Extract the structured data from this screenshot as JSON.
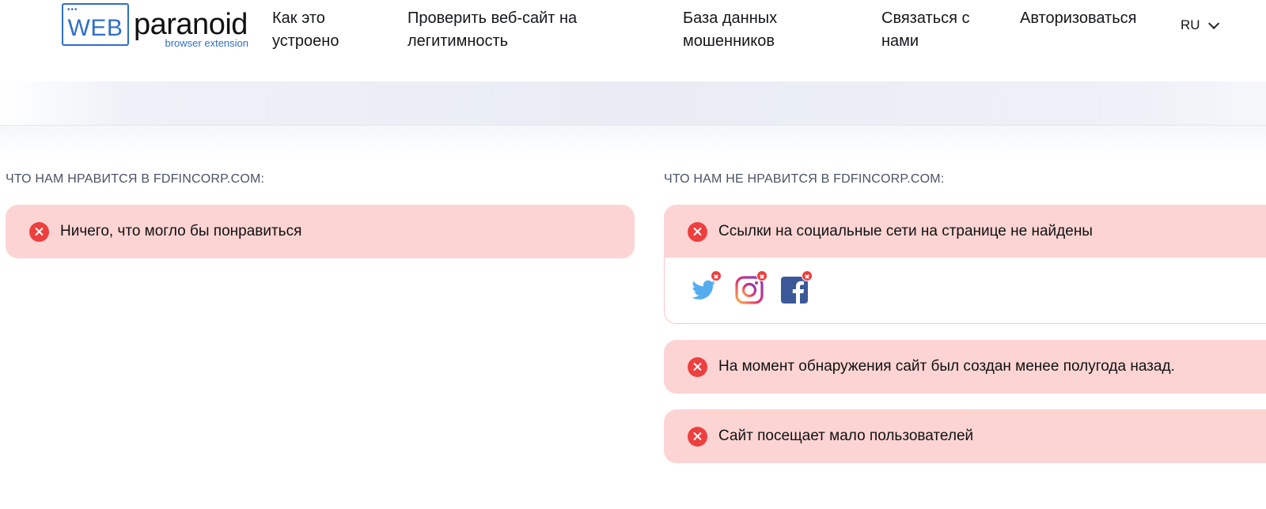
{
  "logo": {
    "dots": "•••",
    "web": "WEB",
    "name": "paranoid",
    "subtitle": "browser extension"
  },
  "nav": {
    "items": [
      {
        "label": "Как это устроено"
      },
      {
        "label": "Проверить веб-сайт на легитимность"
      },
      {
        "label": "База данных мошенников"
      },
      {
        "label": "Связаться с нами"
      },
      {
        "label": "Авторизоваться"
      }
    ],
    "language": "RU"
  },
  "likes": {
    "title": "ЧТО НАМ НРАВИТСЯ В FDFINCORP.COM:",
    "items": [
      {
        "text": "Ничего, что могло бы понравиться",
        "status_icon": "x-circle-icon"
      }
    ]
  },
  "dislikes": {
    "title": "ЧТО НАМ НЕ НРАВИТСЯ В FDFINCORP.COM:",
    "items": [
      {
        "text": "Ссылки на социальные сети на странице не найдены",
        "status_icon": "x-circle-icon"
      },
      {
        "text": "На момент обнаружения сайт был создан менее полугода назад.",
        "status_icon": "x-circle-icon"
      },
      {
        "text": "Сайт посещает мало пользователей",
        "status_icon": "x-circle-icon"
      }
    ],
    "social_icons": [
      "twitter-icon",
      "instagram-icon",
      "facebook-icon"
    ]
  },
  "colors": {
    "brand_blue": "#2f6fc9",
    "card_bg": "#fdd4d4",
    "error_red": "#ee3f3f"
  }
}
